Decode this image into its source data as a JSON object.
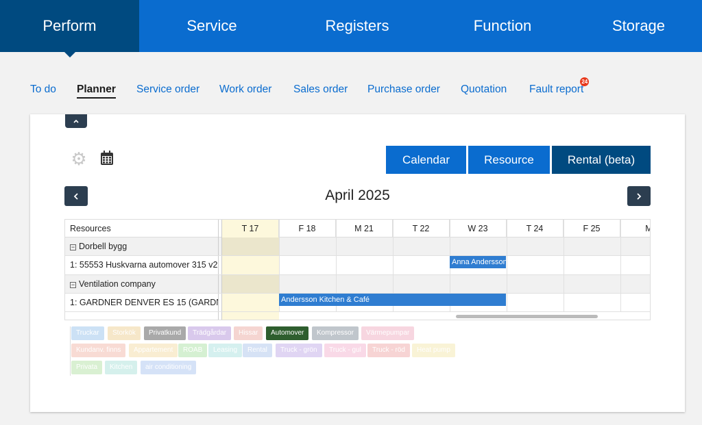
{
  "top_tabs": [
    "Perform",
    "Service",
    "Registers",
    "Function",
    "Storage"
  ],
  "sub_tabs": [
    "To do",
    "Planner",
    "Service order",
    "Work order",
    "Sales order",
    "Purchase order",
    "Quotation",
    "Fault report"
  ],
  "fault_badge": "24",
  "view_buttons": [
    "Calendar",
    "Resource",
    "Rental (beta)"
  ],
  "month_title": "April 2025",
  "grid": {
    "resources_header": "Resources",
    "days": [
      "T 17",
      "F 18",
      "M 21",
      "T 22",
      "W 23",
      "T 24",
      "F 25",
      "M"
    ],
    "rows": [
      {
        "type": "group",
        "label": "Dorbell bygg"
      },
      {
        "type": "resource",
        "label": "1: 55553 Huskvarna automover 315 v2 (",
        "event": "Anna Andersson"
      },
      {
        "type": "group",
        "label": "Ventilation company"
      },
      {
        "type": "resource",
        "label": "1: GARDNER DENVER ES 15 (GARDNER D",
        "event": "Andersson Kitchen & Café"
      }
    ]
  },
  "legend": [
    {
      "label": "Truckar",
      "color": "#bcd8f2"
    },
    {
      "label": "Storkök",
      "color": "#f3dfb8"
    },
    {
      "label": "Privatkund",
      "color": "#a9a9a9"
    },
    {
      "label": "Trädgårdar",
      "color": "#cdb7e6"
    },
    {
      "label": "Hissar",
      "color": "#f2c8c2"
    },
    {
      "label": "Automover",
      "color": "#2e5e2e"
    },
    {
      "label": "Kompressor",
      "color": "#c0c6cc"
    },
    {
      "label": "Värmepumpar",
      "color": "#f5c9d6"
    },
    {
      "label": "Kundanv. finns",
      "color": "#f6cfc6"
    },
    {
      "label": "Appartement",
      "color": "#f7e8c3"
    },
    {
      "label": "ROAB",
      "color": "#c8ecc4"
    },
    {
      "label": "Leasing",
      "color": "#c7ecea"
    },
    {
      "label": "Rental",
      "color": "#c9d9f2"
    },
    {
      "label": "Truck - grön",
      "color": "#d6c7f0"
    },
    {
      "label": "Truck - gul",
      "color": "#f7cde0"
    },
    {
      "label": "Truck - röd",
      "color": "#f5c6c6"
    },
    {
      "label": "Heat pump",
      "color": "#f7efc9"
    },
    {
      "label": "Privata",
      "color": "#cdebc4"
    },
    {
      "label": "Kitchen",
      "color": "#c7ece6"
    },
    {
      "label": "air conditioning",
      "color": "#c8d9f5"
    }
  ]
}
